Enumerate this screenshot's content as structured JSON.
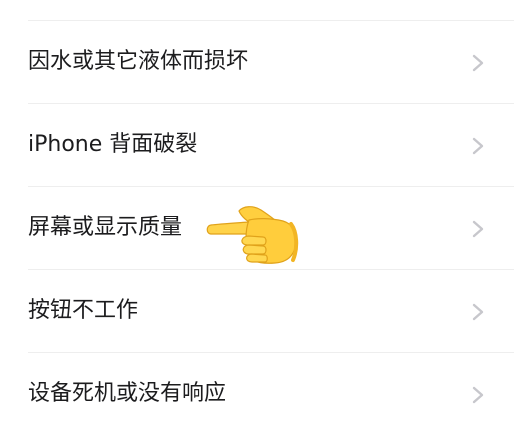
{
  "rows": [
    {
      "label": "因水或其它液体而损坏"
    },
    {
      "label": "iPhone 背面破裂"
    },
    {
      "label": "屏幕或显示质量"
    },
    {
      "label": "按钮不工作"
    },
    {
      "label": "设备死机或没有响应"
    }
  ],
  "pointer": {
    "icon": "backhand-index-pointing-left-emoji",
    "target_row": "屏幕或显示质量"
  },
  "colors": {
    "text": "#1c1c1e",
    "chevron": "#c7c7cc",
    "divider": "#eeeeee",
    "background": "#ffffff"
  }
}
